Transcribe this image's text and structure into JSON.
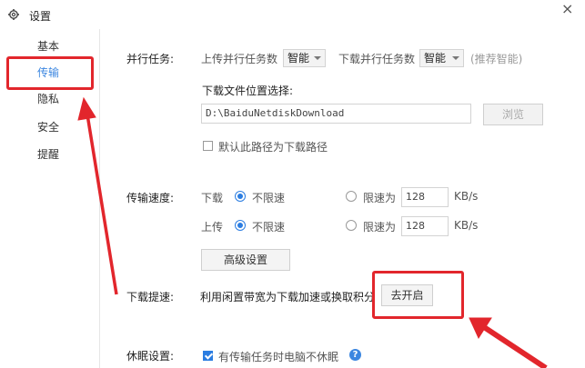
{
  "window": {
    "title": "设置",
    "close_glyph": "×"
  },
  "sidebar": {
    "items": [
      {
        "label": "基本"
      },
      {
        "label": "传输"
      },
      {
        "label": "隐私"
      },
      {
        "label": "安全"
      },
      {
        "label": "提醒"
      }
    ],
    "active_index": 1
  },
  "parallel": {
    "label": "并行任务:",
    "upload_label": "上传并行任务数",
    "upload_value": "智能",
    "download_label": "下载并行任务数",
    "download_value": "智能",
    "hint": "(推荐智能)"
  },
  "download_location": {
    "label": "下载文件位置选择:",
    "path": "D:\\BaiduNetdiskDownload",
    "browse_label": "浏览",
    "default_checkbox_label": "默认此路径为下载路径",
    "default_checked": false
  },
  "speed": {
    "label": "传输速度:",
    "download_label": "下载",
    "upload_label": "上传",
    "unlimited_label": "不限速",
    "limit_label": "限速为",
    "download_limit_value": "128",
    "upload_limit_value": "128",
    "unit": "KB/s",
    "download_mode": "unlimited",
    "upload_mode": "unlimited",
    "advanced_label": "高级设置"
  },
  "boost": {
    "label": "下载提速:",
    "text": "利用闲置带宽为下载加速或换取积分",
    "button_label": "去开启"
  },
  "sleep": {
    "label": "休眠设置:",
    "checkbox_label": "有传输任务时电脑不休眠",
    "checked": true,
    "help_glyph": "?"
  },
  "colors": {
    "accent": "#2b7de1",
    "annotation": "#e2262c"
  }
}
